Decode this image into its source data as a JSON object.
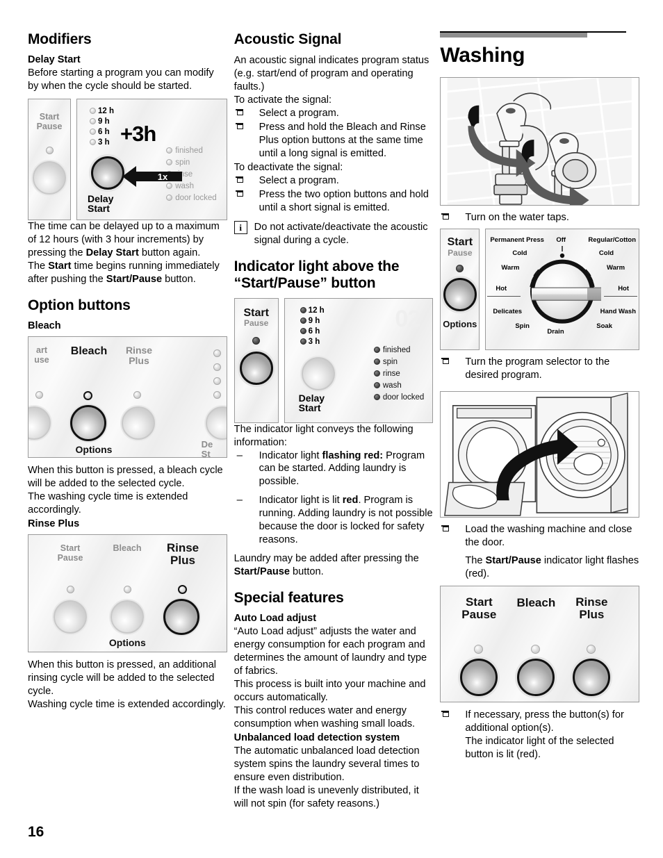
{
  "page": {
    "number": "16"
  },
  "col1": {
    "h_modifiers": "Modifiers",
    "h_delay_start": "Delay Start",
    "p_delay_intro": "Before starting a program you can modify by when the cycle should be started.",
    "fig_delay": {
      "start_pause_label_line1": "Start",
      "start_pause_label_line2": "Pause",
      "timers": [
        "12 h",
        "9 h",
        "6 h",
        "3 h"
      ],
      "plus_label": "+3h",
      "press_count": "1x",
      "delay_label_line1": "Delay",
      "delay_label_line2": "Start",
      "status_lights": [
        "finished",
        "spin",
        "rinse",
        "wash",
        "door locked"
      ]
    },
    "p_delay_max": "The time can be delayed up to a maximum of 12 hours (with 3 hour increments) by pressing the ",
    "p_delay_max_b1": "Delay Start",
    "p_delay_max_2": " button again.",
    "p_start_time": "The ",
    "p_start_time_b": "Start",
    "p_start_time_2": " time begins running immediately after pushing the ",
    "p_start_time_b2": "Start/Pause",
    "p_start_time_3": " button.",
    "h_option_buttons": "Option buttons",
    "h_bleach": "Bleach",
    "fig_bleach": {
      "crop_left_line1": "art",
      "crop_left_line2": "use",
      "bleach_label": "Bleach",
      "rinse_label_line1": "Rinse",
      "rinse_label_line2": "Plus",
      "options_label": "Options",
      "crop_right_line1": "De",
      "crop_right_line2": "St"
    },
    "p_bleach_1": "When this button is pressed, a bleach cycle will be added to the selected cycle.",
    "p_bleach_2": "The washing cycle time is extended accordingly.",
    "h_rinse_plus": "Rinse Plus",
    "fig_rinse": {
      "start_line1": "Start",
      "start_line2": "Pause",
      "bleach_label": "Bleach",
      "rinse_line1": "Rinse",
      "rinse_line2": "Plus",
      "options_label": "Options"
    },
    "p_rinse_1": "When this button is pressed, an additional rinsing cycle will be added to the selected cycle.",
    "p_rinse_2": "Washing cycle time is extended accordingly."
  },
  "col2": {
    "h_acoustic": "Acoustic Signal",
    "p_acoustic_intro": "An acoustic signal indicates program status (e.g. start/end of program and operating faults.)",
    "p_activate": "To activate the signal:",
    "activate_steps": [
      "Select a program.",
      "Press and hold the Bleach and Rinse Plus option buttons at the same time until a long signal is emitted."
    ],
    "p_deactivate": "To deactivate the signal:",
    "deactivate_steps": [
      "Select a program.",
      "Press the two option buttons and hold until a short signal is emitted."
    ],
    "note_icon": "i",
    "note_text": "Do not activate/deactivate the acoustic signal during a cycle.",
    "h_indicator": "Indicator light above the “Start/Pause” button",
    "fig_indicator": {
      "start_label": "Start",
      "pause_label": "Pause",
      "timers": [
        "12 h",
        "9 h",
        "6 h",
        "3 h"
      ],
      "ghost_display": "02",
      "delay_line1": "Delay",
      "delay_line2": "Start",
      "status_lights": [
        "finished",
        "spin",
        "rinse",
        "wash",
        "door locked"
      ]
    },
    "p_conveys": "The indicator light conveys the following information:",
    "dash_items": [
      {
        "pre": "Indicator light ",
        "bold": "flashing red:",
        "post": " Program can be started. Adding laundry is possible."
      },
      {
        "pre": "Indicator light is lit ",
        "bold": "red",
        "post": ". Program is running. Adding laundry is not possible because the door is locked for safety reasons."
      }
    ],
    "p_laundry_added_1": "Laundry may be added after pressing the ",
    "p_laundry_added_b": "Start/Pause",
    "p_laundry_added_2": " button.",
    "h_special": "Special features",
    "h_auto_load": "Auto Load adjust",
    "p_auto_1": "“Auto Load adjust” adjusts the water and energy consumption for each program and determines the amount of laundry and type of fabrics.",
    "p_auto_2": "This process is built into your machine and occurs automatically.",
    "p_auto_3": "This control reduces water and energy consumption when washing small loads.",
    "h_unbalanced": "Unbalanced load detection system",
    "p_unb_1": "The automatic unbalanced load detection system spins the laundry several times to ensure even distribution.",
    "p_unb_2": "If the wash load is unevenly distributed, it will not spin (for safety reasons.)"
  },
  "col3": {
    "h_washing": "Washing",
    "step_taps": "Turn on the water taps.",
    "fig_selector": {
      "start_label": "Start",
      "pause_label": "Pause",
      "options_label": "Options",
      "dial_labels": {
        "permanent_press": "Permanent Press",
        "off": "Off",
        "regular_cotton": "Regular/Cotton",
        "cold_left": "Cold",
        "cold_right": "Cold",
        "warm_left": "Warm",
        "warm_right": "Warm",
        "hot_left": "Hot",
        "hot_right": "Hot",
        "delicates": "Delicates",
        "hand_wash": "Hand Wash",
        "spin": "Spin",
        "drain": "Drain",
        "soak": "Soak"
      }
    },
    "step_selector": "Turn the program selector to the desired program.",
    "step_load": "Load the washing machine and close the door.",
    "p_flash": "The ",
    "p_flash_b": "Start/Pause",
    "p_flash_2": " indicator light flashes (red).",
    "fig_buttons": {
      "start_line1": "Start",
      "start_line2": "Pause",
      "bleach_label": "Bleach",
      "rinse_line1": "Rinse",
      "rinse_line2": "Plus"
    },
    "step_options_1": "If necessary, press the button(s) for additional option(s).",
    "step_options_2": "The indicator light of the selected button is lit (red)."
  },
  "colors": {
    "rule": "#8f8f8f",
    "panel": "#f2f2f2",
    "led_off": "#c8c8c8",
    "led_on": "#3a3a3a",
    "text": "#000000",
    "muted": "#8d8d8d"
  }
}
